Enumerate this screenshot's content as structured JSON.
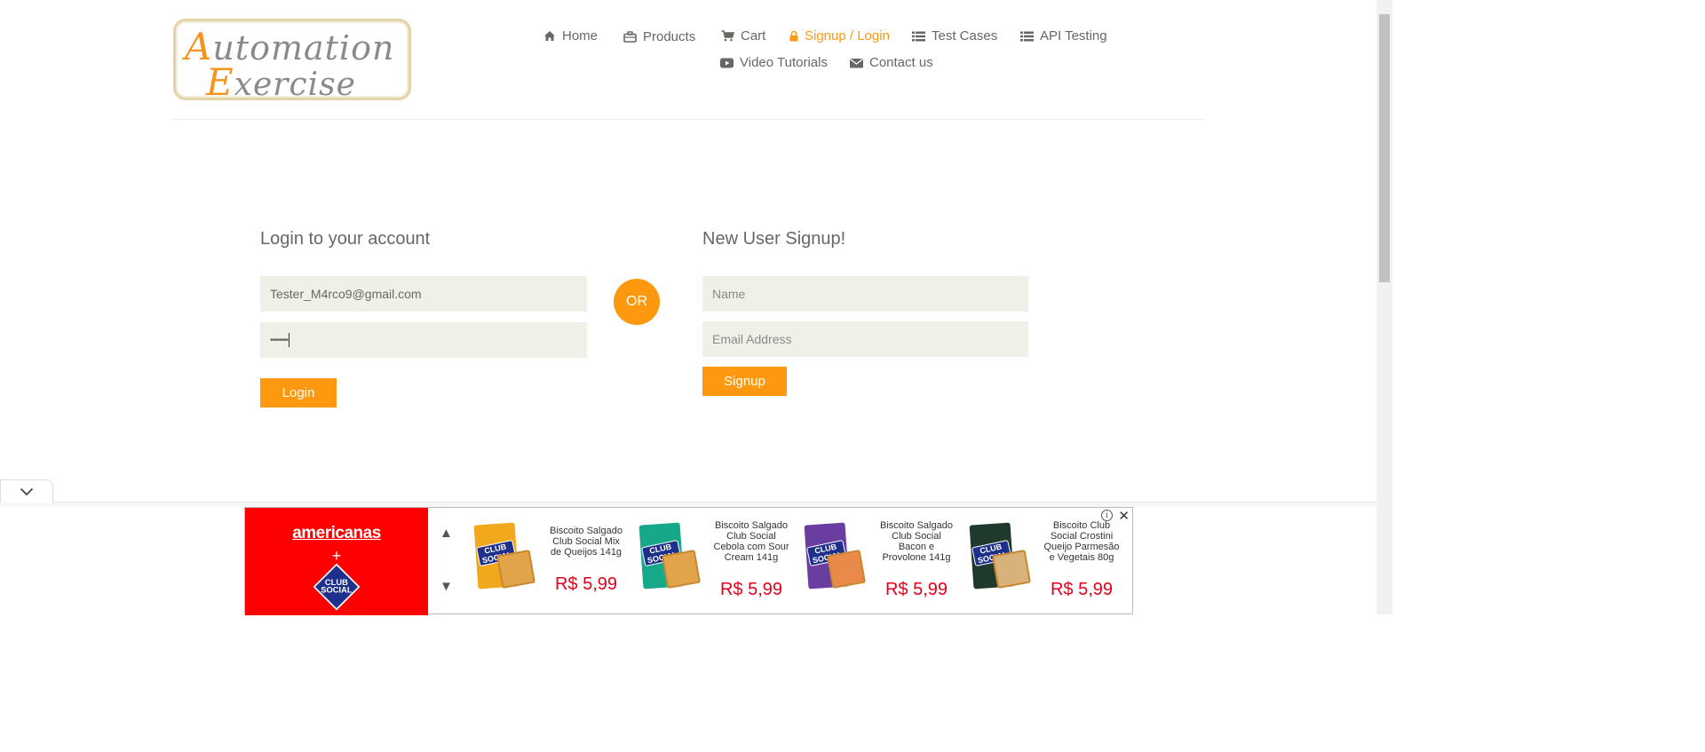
{
  "logo": {
    "line1_cap": "A",
    "line1_rest": "utomation",
    "line2_cap": "E",
    "line2_rest": "xercise"
  },
  "nav": {
    "home": "Home",
    "products": "Products",
    "cart": "Cart",
    "signup_login": "Signup / Login",
    "test_cases": "Test Cases",
    "api_testing": "API Testing",
    "video_tutorials": "Video Tutorials",
    "contact_us": "Contact us"
  },
  "colors": {
    "accent": "#FE980F",
    "field_bg": "#F0F0E9",
    "text": "#696763",
    "ad_red": "#ff0000"
  },
  "login": {
    "title": "Login to your account",
    "email_value": "Tester_M4rco9@gmail.com",
    "password_value": "••••••••",
    "button": "Login"
  },
  "or_label": "OR",
  "signup": {
    "title": "New User Signup!",
    "name_placeholder": "Name",
    "email_placeholder": "Email Address",
    "button": "Signup"
  },
  "ad": {
    "brand": "americanas",
    "plus": "+",
    "partner": "CLUB SOCIAL",
    "up_arrow": "▲",
    "down_arrow": "▼",
    "info": "i",
    "close": "✕",
    "products": [
      {
        "name": "Biscoito Salgado Club Social Mix de Queijos 141g",
        "price": "R$ 5,99",
        "pack_color": "#f2a81d"
      },
      {
        "name": "Biscoito Salgado Club Social Cebola com Sour Cream 141g",
        "price": "R$ 5,99",
        "pack_color": "#17a88a"
      },
      {
        "name": "Biscoito Salgado Club Social Bacon e Provolone 141g",
        "price": "R$ 5,99",
        "pack_color": "#6a3da0"
      },
      {
        "name": "Biscoito Club Social Crostini Queijo Parmesão e Vegetais 80g",
        "price": "R$ 5,99",
        "pack_color": "#1f3a2c"
      }
    ]
  }
}
